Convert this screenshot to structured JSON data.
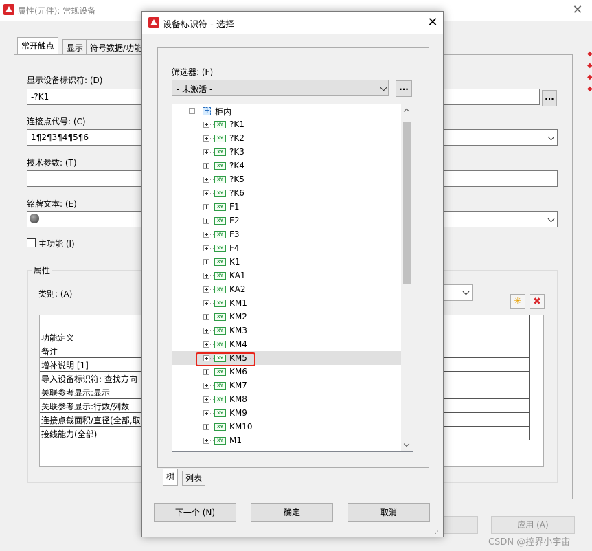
{
  "background_window": {
    "title": "属性(元件): 常规设备",
    "tabs": [
      "常开触点",
      "显示",
      "符号数据/功能"
    ],
    "fields": {
      "device_tag_label": "显示设备标识符: (D)",
      "device_tag_value": "-?K1",
      "connection_label": "连接点代号: (C)",
      "connection_value": "1¶2¶3¶4¶5¶6",
      "tech_param_label": "技术参数: (T)",
      "tech_param_value": "",
      "nameplate_label": "铭牌文本: (E)",
      "nameplate_value": "",
      "main_function_label": "主功能 (I)",
      "main_function_checked": false
    },
    "attributes_group": {
      "title": "属性",
      "category_label": "类别: (A)",
      "rows": [
        "功能定义",
        "备注",
        "增补说明 [1]",
        "导入设备标识符: 查找方向",
        "关联参考显示:显示",
        "关联参考显示:行数/列数",
        "连接点截面积/直径(全部,取",
        "接线能力(全部)"
      ]
    },
    "buttons": {
      "dots": "...",
      "apply": "应用 (A)"
    },
    "watermark": "CSDN @控界小宇宙"
  },
  "dialog": {
    "title": "设备标识符 - 选择",
    "filter_label": "筛选器: (F)",
    "filter_value": "- 未激活 -",
    "filter_dots": "...",
    "tree": {
      "root": "柜内",
      "items": [
        "?K1",
        "?K2",
        "?K3",
        "?K4",
        "?K5",
        "?K6",
        "F1",
        "F2",
        "F3",
        "F4",
        "K1",
        "KA1",
        "KA2",
        "KM1",
        "KM2",
        "KM3",
        "KM4",
        "KM5",
        "KM6",
        "KM7",
        "KM8",
        "KM9",
        "KM10",
        "M1"
      ],
      "selected": "KM5",
      "icon_text": "XY"
    },
    "tabs": [
      "树",
      "列表"
    ],
    "buttons": {
      "next": "下一个 (N)",
      "ok": "确定",
      "cancel": "取消"
    }
  },
  "colors": {
    "highlight": "#e8261c",
    "icon_green": "#2f9d47",
    "app_red": "#d9252a"
  }
}
